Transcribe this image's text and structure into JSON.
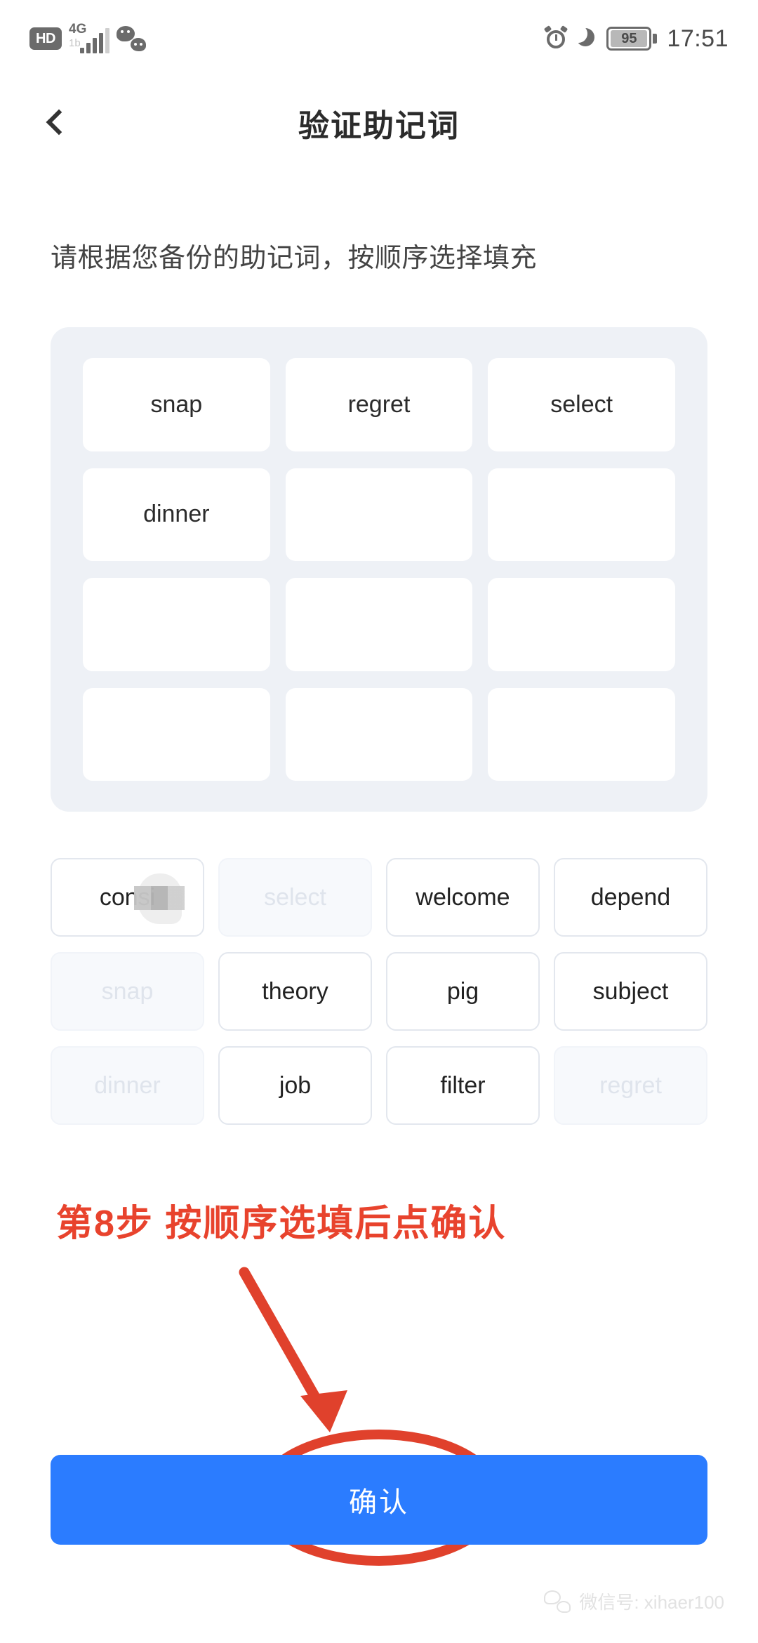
{
  "status_bar": {
    "hd_label": "HD",
    "network_label": "4G",
    "downlink_label": "1b",
    "signal_bars": 5,
    "battery_percent": "95",
    "time": "17:51",
    "icons": [
      "hd-badge",
      "signal-icon",
      "wechat-icon",
      "alarm-icon",
      "moon-icon",
      "battery-icon"
    ]
  },
  "header": {
    "back_icon": "chevron-left-icon",
    "title": "验证助记词"
  },
  "instruction": "请根据您备份的助记词，按顺序选择填充",
  "slots": {
    "rows": 4,
    "columns": 3,
    "values": [
      "snap",
      "regret",
      "select",
      "dinner",
      "",
      "",
      "",
      "",
      "",
      "",
      "",
      ""
    ]
  },
  "word_bank": {
    "columns": 4,
    "words": [
      {
        "label": "consi",
        "used": false,
        "masked": true
      },
      {
        "label": "select",
        "used": true,
        "masked": false
      },
      {
        "label": "welcome",
        "used": false,
        "masked": false
      },
      {
        "label": "depend",
        "used": false,
        "masked": false
      },
      {
        "label": "snap",
        "used": true,
        "masked": false
      },
      {
        "label": "theory",
        "used": false,
        "masked": false
      },
      {
        "label": "pig",
        "used": false,
        "masked": false
      },
      {
        "label": "subject",
        "used": false,
        "masked": false
      },
      {
        "label": "dinner",
        "used": true,
        "masked": false
      },
      {
        "label": "job",
        "used": false,
        "masked": false
      },
      {
        "label": "filter",
        "used": false,
        "masked": false
      },
      {
        "label": "regret",
        "used": true,
        "masked": false
      }
    ]
  },
  "annotation": {
    "step_text": "第8步  按顺序选填后点确认",
    "color": "#e8432d",
    "arrow": "down-arrow-annotation",
    "ellipse": "confirm-highlight-ellipse"
  },
  "confirm": {
    "label": "确认",
    "color": "#2b7cff"
  },
  "footer": {
    "watermark": "微信号: xihaer100",
    "icon": "wechat-icon"
  }
}
